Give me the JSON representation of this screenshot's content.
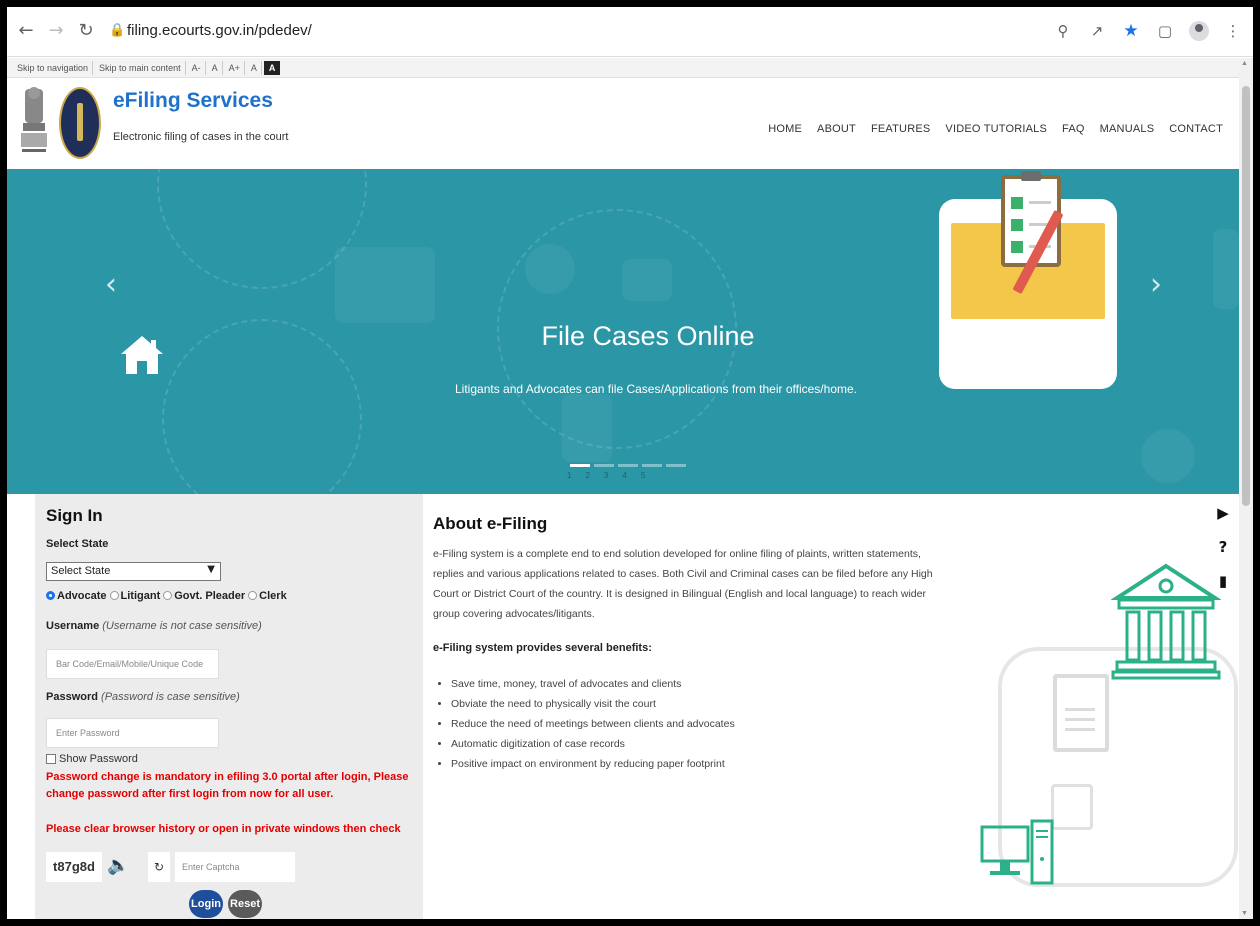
{
  "browser": {
    "url": "filing.ecourts.gov.in/pdedev/"
  },
  "a11y_bar": {
    "skip_nav": "Skip to navigation",
    "skip_main": "Skip to main content",
    "font_minus": "A-",
    "font_normal": "A",
    "font_plus": "A+",
    "contrast_light": "A",
    "contrast_dark": "A"
  },
  "header": {
    "title": "eFiling Services",
    "subtitle": "Electronic filing of cases in the court",
    "nav": [
      "HOME",
      "ABOUT",
      "FEATURES",
      "VIDEO TUTORIALS",
      "FAQ",
      "MANUALS",
      "CONTACT"
    ]
  },
  "carousel": {
    "title": "File Cases Online",
    "subtitle": "Litigants and Advocates can file Cases/Applications from their offices/home.",
    "indicators": [
      "1",
      "2",
      "3",
      "4",
      "5"
    ],
    "active_index": 0,
    "bg_color": "#2a96a6"
  },
  "signin": {
    "heading": "Sign In",
    "state_label": "Select State",
    "state_value": "Select State",
    "roles": [
      "Advocate",
      "Litigant",
      "Govt. Pleader",
      "Clerk"
    ],
    "selected_role": "Advocate",
    "username_label": "Username",
    "username_hint": "(Username is not case sensitive)",
    "username_placeholder": "Bar Code/Email/Mobile/Unique Code",
    "password_label": "Password",
    "password_hint": "(Password is case sensitive)",
    "password_placeholder": "Enter Password",
    "show_password": "Show Password",
    "warning_1": "Password change is mandatory in efiling 3.0 portal after login, Please change password after first login from now for all user.",
    "warning_2": "Please clear browser history or open in private windows then check",
    "captcha_text": "t87g8d",
    "captcha_placeholder": "Enter Captcha",
    "login_label": "Login",
    "reset_label": "Reset",
    "warning_color": "#e40000"
  },
  "about": {
    "heading": "About e-Filing",
    "paragraph": "e-Filing system is a complete end to end solution developed for online filing of plaints, written statements, replies and various applications related to cases. Both Civil and Criminal cases can be filed before any High Court or District Court of the country. It is designed in Bilingual (English and local language) to reach wider group covering advocates/litigants.",
    "benefits_title": "e-Filing system provides several benefits:",
    "benefits": [
      "Save time, money, travel of advocates and clients",
      "Obviate the need to physically visit the court",
      "Reduce the need of meetings between clients and advocates",
      "Automatic digitization of case records",
      "Positive impact on environment by reducing paper footprint"
    ]
  },
  "side_icons": [
    "play-circle-icon",
    "help-circle-icon",
    "pdf-icon"
  ]
}
